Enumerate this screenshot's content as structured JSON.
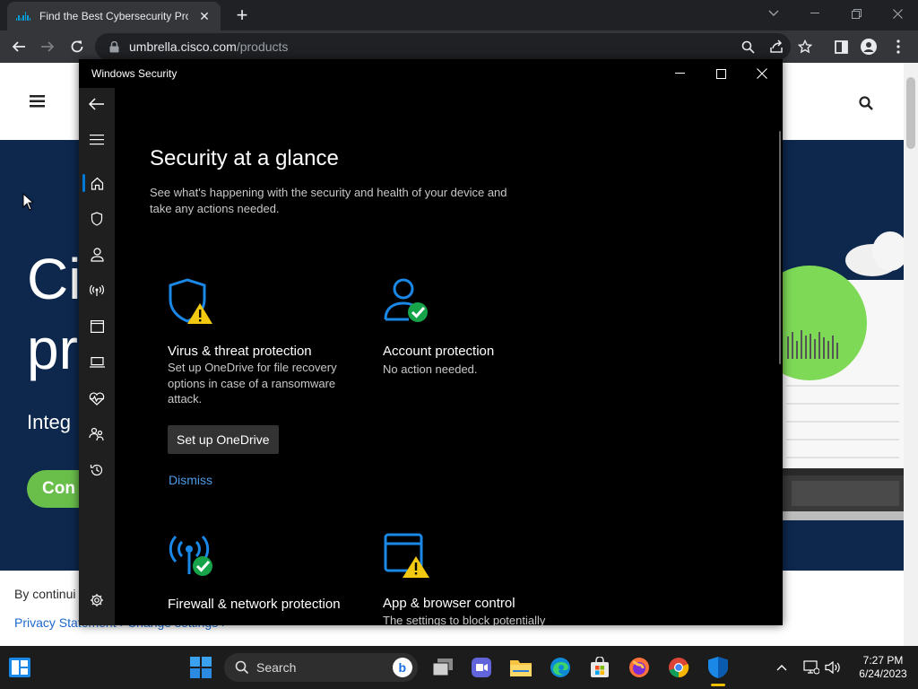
{
  "browser": {
    "tab_title": "Find the Best Cybersecurity Prod",
    "tab_close": "✕",
    "new_tab": "+",
    "url_host": "umbrella.cisco.com",
    "url_path": "/products"
  },
  "website": {
    "hero_line1": "Ci",
    "hero_line2": "pr",
    "hero_sub": "Integ",
    "hero_button": "Con",
    "footer_text": "By continui",
    "footer_links": "Privacy Statement  ›   Change settings  ›"
  },
  "security_window": {
    "title": "Windows Security",
    "heading": "Security at a glance",
    "description": "See what's happening with the security and health of your device and take any actions needed.",
    "cards": {
      "virus": {
        "title": "Virus & threat protection",
        "desc": "Set up OneDrive for file recovery options in case of a ransomware attack.",
        "button": "Set up OneDrive",
        "link": "Dismiss"
      },
      "account": {
        "title": "Account protection",
        "desc": "No action needed."
      },
      "firewall": {
        "title": "Firewall & network protection"
      },
      "app_browser": {
        "title": "App & browser control",
        "desc": "The settings to block potentially"
      }
    }
  },
  "taskbar": {
    "search_label": "Search",
    "time": "7:27 PM",
    "date": "6/24/2023"
  },
  "colors": {
    "accent_blue": "#0078d4",
    "warning_yellow": "#f2c811",
    "ok_green": "#16a34a",
    "cisco_navy": "#0d274d"
  }
}
